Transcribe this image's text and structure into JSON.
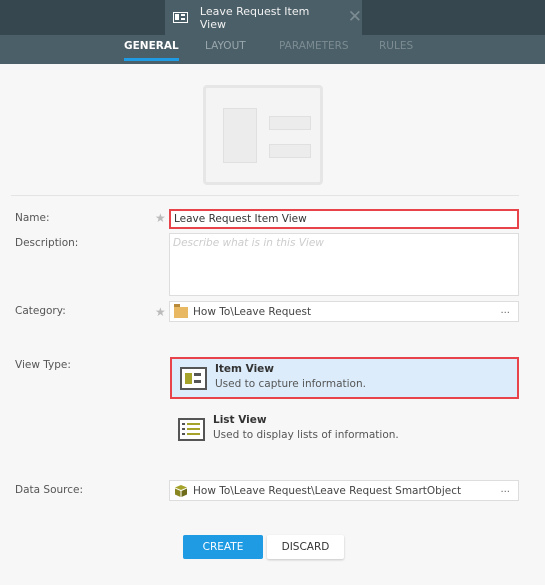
{
  "window": {
    "tab_title": "Leave Request Item View",
    "tab_icon": "item-view-icon",
    "close_icon": "close-icon"
  },
  "tabs": [
    {
      "label": "GENERAL",
      "state": "active"
    },
    {
      "label": "LAYOUT",
      "state": "enabled"
    },
    {
      "label": "PARAMETERS",
      "state": "disabled"
    },
    {
      "label": "RULES",
      "state": "disabled"
    }
  ],
  "form": {
    "name": {
      "label": "Name:",
      "value": "Leave Request Item View",
      "required": true
    },
    "description": {
      "label": "Description:",
      "value": "",
      "placeholder": "Describe what is in this View"
    },
    "category": {
      "label": "Category:",
      "value": "How To\\Leave Request",
      "required": true,
      "icon": "folder-icon",
      "browse": "..."
    },
    "view_type": {
      "label": "View Type:",
      "options": [
        {
          "title": "Item View",
          "description": "Used to capture information.",
          "selected": true,
          "icon": "item-view-icon"
        },
        {
          "title": "List View",
          "description": "Used to display lists of information.",
          "selected": false,
          "icon": "list-view-icon"
        }
      ]
    },
    "data_source": {
      "label": "Data Source:",
      "value": "How To\\Leave Request\\Leave Request SmartObject",
      "icon": "smartobject-icon",
      "browse": "..."
    }
  },
  "actions": {
    "create": "CREATE",
    "discard": "DISCARD"
  },
  "colors": {
    "accent": "#1f9be3",
    "highlight_border": "#e8434a",
    "selected_bg": "#dcecfb",
    "header_bg": "#36474f",
    "tab_bg": "#4b5f68"
  }
}
